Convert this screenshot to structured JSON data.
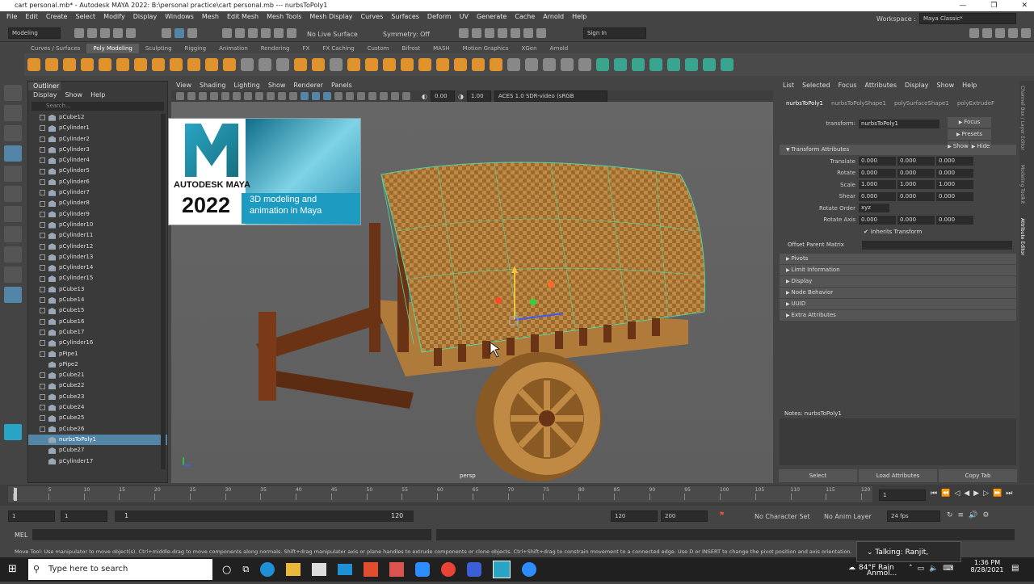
{
  "window": {
    "title": "cart personal.mb* - Autodesk MAYA 2022: B:\\personal practice\\cart personal.mb    ---   nurbsToPoly1",
    "controls": [
      "—",
      "❐",
      "✕"
    ]
  },
  "menubar": [
    "File",
    "Edit",
    "Create",
    "Select",
    "Modify",
    "Display",
    "Windows",
    "Mesh",
    "Edit Mesh",
    "Mesh Tools",
    "Mesh Display",
    "Curves",
    "Surfaces",
    "Deform",
    "UV",
    "Generate",
    "Cache",
    "Arnold",
    "Help"
  ],
  "workspace": {
    "label": "Workspace :",
    "value": "Maya Classic*"
  },
  "statusline": {
    "mode": "Modeling",
    "live_surface": "No Live Surface",
    "symmetry": "Symmetry: Off",
    "sign_in": "Sign In"
  },
  "shelf_tabs": [
    "Curves / Surfaces",
    "Poly Modeling",
    "Sculpting",
    "Rigging",
    "Animation",
    "Rendering",
    "FX",
    "FX Caching",
    "Custom",
    "Bifrost",
    "MASH",
    "Motion Graphics",
    "XGen",
    "Arnold"
  ],
  "shelf_active": "Poly Modeling",
  "outliner": {
    "tab": "Outliner",
    "menu": [
      "Display",
      "Show",
      "Help"
    ],
    "search_placeholder": "Search...",
    "items": [
      {
        "name": "pCube12",
        "expand": true
      },
      {
        "name": "pCylinder1",
        "expand": true
      },
      {
        "name": "pCylinder2",
        "expand": true
      },
      {
        "name": "pCylinder3",
        "expand": true
      },
      {
        "name": "pCylinder4",
        "expand": true
      },
      {
        "name": "pCylinder5",
        "expand": true
      },
      {
        "name": "pCylinder6",
        "expand": true
      },
      {
        "name": "pCylinder7",
        "expand": true
      },
      {
        "name": "pCylinder8",
        "expand": true
      },
      {
        "name": "pCylinder9",
        "expand": true
      },
      {
        "name": "pCylinder10",
        "expand": true
      },
      {
        "name": "pCylinder11",
        "expand": true
      },
      {
        "name": "pCylinder12",
        "expand": true
      },
      {
        "name": "pCylinder13",
        "expand": true
      },
      {
        "name": "pCylinder14",
        "expand": true
      },
      {
        "name": "pCylinder15",
        "expand": true
      },
      {
        "name": "pCube13",
        "expand": true
      },
      {
        "name": "pCube14",
        "expand": true
      },
      {
        "name": "pCube15",
        "expand": true
      },
      {
        "name": "pCube16",
        "expand": true
      },
      {
        "name": "pCube17",
        "expand": true
      },
      {
        "name": "pCylinder16",
        "expand": true
      },
      {
        "name": "pPipe1",
        "expand": true
      },
      {
        "name": "pPipe2",
        "expand": false
      },
      {
        "name": "pCube21",
        "expand": true
      },
      {
        "name": "pCube22",
        "expand": true
      },
      {
        "name": "pCube23",
        "expand": true
      },
      {
        "name": "pCube24",
        "expand": true
      },
      {
        "name": "pCube25",
        "expand": true
      },
      {
        "name": "pCube26",
        "expand": true
      },
      {
        "name": "nurbsToPoly1",
        "expand": false,
        "selected": true
      },
      {
        "name": "pCube27",
        "expand": false
      },
      {
        "name": "pCylinder17",
        "expand": false
      }
    ]
  },
  "viewport": {
    "menu": [
      "View",
      "Shading",
      "Lighting",
      "Show",
      "Renderer",
      "Panels"
    ],
    "exposure": "0.00",
    "gamma": "1.00",
    "colorspace": "ACES 1.0 SDR-video (sRGB",
    "camera": "persp"
  },
  "banner": {
    "brand": "AUTODESK MAYA",
    "year": "2022",
    "tagline_1": "3D modeling and",
    "tagline_2": "animation in Maya"
  },
  "attribute_editor": {
    "menu": [
      "List",
      "Selected",
      "Focus",
      "Attributes",
      "Display",
      "Show",
      "Help"
    ],
    "tabs": [
      "nurbsToPoly1",
      "nurbsToPolyShape1",
      "polySurfaceShape1",
      "polyExtrudeF"
    ],
    "transform_label": "transform:",
    "transform_value": "nurbsToPoly1",
    "buttons": {
      "focus": "Focus",
      "presets": "Presets",
      "show": "Show",
      "hide": "Hide"
    },
    "section_title": "Transform Attributes",
    "rows": [
      {
        "label": "Translate",
        "values": [
          "0.000",
          "0.000",
          "0.000"
        ]
      },
      {
        "label": "Rotate",
        "values": [
          "0.000",
          "0.000",
          "0.000"
        ]
      },
      {
        "label": "Scale",
        "values": [
          "1.000",
          "1.000",
          "1.000"
        ]
      },
      {
        "label": "Shear",
        "values": [
          "0.000",
          "0.000",
          "0.000"
        ]
      }
    ],
    "rotate_order_label": "Rotate Order",
    "rotate_order_value": "xyz",
    "rotate_axis": {
      "label": "Rotate Axis",
      "values": [
        "0.000",
        "0.000",
        "0.000"
      ]
    },
    "inherits_transform": "Inherits Transform",
    "offset_parent_matrix": "Offset Parent Matrix",
    "sections": [
      "Pivots",
      "Limit Information",
      "Display",
      "Node Behavior",
      "UUID",
      "Extra Attributes"
    ],
    "notes_label": "Notes:  nurbsToPoly1",
    "bottom_buttons": [
      "Select",
      "Load Attributes",
      "Copy Tab"
    ]
  },
  "side_tabs": [
    "Channel Box / Layer Editor",
    "Modeling Toolkit",
    "Attribute Editor"
  ],
  "timeline": {
    "ticks": [
      "1",
      "5",
      "10",
      "15",
      "20",
      "25",
      "30",
      "35",
      "40",
      "45",
      "50",
      "55",
      "60",
      "65",
      "70",
      "75",
      "80",
      "85",
      "90",
      "95",
      "100",
      "105",
      "110",
      "115",
      "120"
    ],
    "current_frame": "1"
  },
  "range": {
    "start": "1",
    "start_inner": "1",
    "slider_start": "1",
    "slider_end": "120",
    "end_inner": "120",
    "end": "200",
    "character_set": "No Character Set",
    "anim_layer": "No Anim Layer",
    "fps": "24 fps"
  },
  "mel_label": "MEL",
  "help_line": "Move Tool: Use manipulator to move object(s). Ctrl+middle-drag to move components along normals. Shift+drag manipulator axis or plane handles to extrude components or clone objects. Ctrl+Shift+drag to constrain movement to a connected edge. Use D or INSERT to change the pivot position and axis orientation.",
  "toast": "Talking: Ranjit, Anmol...",
  "taskbar": {
    "search_placeholder": "Type here to search",
    "weather": "84°F  Rain",
    "time": "1:36 PM",
    "date": "8/28/2021"
  }
}
